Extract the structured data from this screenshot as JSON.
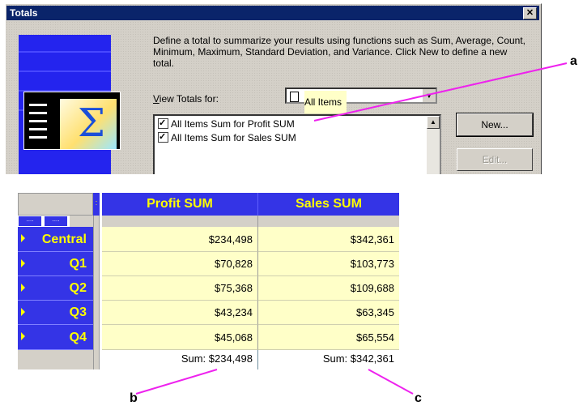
{
  "dialog": {
    "title": "Totals",
    "close_glyph": "✕",
    "description": "Define a total to summarize your results using functions such as Sum, Average, Count, Minimum, Maximum, Standard Deviation, and Variance. Click New to define a new total.",
    "view_label_u": "V",
    "view_label_rest": "iew Totals for:",
    "view_select_value": "All Items",
    "totals": [
      "All Items Sum for Profit SUM",
      "All Items Sum for Sales SUM"
    ],
    "new_label": "New...",
    "edit_label": "Edit..."
  },
  "grid": {
    "columns": [
      "Profit SUM",
      "Sales SUM"
    ],
    "rows": [
      {
        "label": "Central",
        "profit": "$234,498",
        "sales": "$342,361"
      },
      {
        "label": "Q1",
        "profit": "$70,828",
        "sales": "$103,773"
      },
      {
        "label": "Q2",
        "profit": "$75,368",
        "sales": "$109,688"
      },
      {
        "label": "Q3",
        "profit": "$43,234",
        "sales": "$63,345"
      },
      {
        "label": "Q4",
        "profit": "$45,068",
        "sales": "$65,554"
      }
    ],
    "sums": {
      "profit": "Sum: $234,498",
      "sales": "Sum: $342,361"
    },
    "ellipsis": "....",
    "colon": ":"
  },
  "callouts": {
    "a": "a",
    "b": "b",
    "c": "c"
  },
  "colors": {
    "header_bg": "#3434e6",
    "header_text": "#ffff00",
    "cell_bg": "#ffffc8",
    "callout_line": "#ee22ee"
  }
}
